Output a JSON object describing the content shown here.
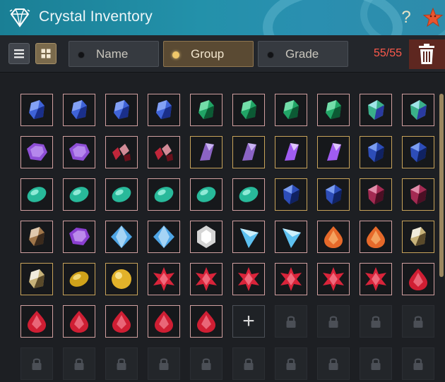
{
  "window": {
    "title": "Crystal Inventory",
    "help_label": "?"
  },
  "toolbar": {
    "sort_options": [
      {
        "label": "Name",
        "active": false
      },
      {
        "label": "Group",
        "active": true
      },
      {
        "label": "Grade",
        "active": false
      }
    ],
    "capacity": "55/55"
  },
  "colors": {
    "title_bar": "#1f8aa2",
    "count_text": "#ff5a4c",
    "active_tab": "#5a4a33",
    "trash_bg": "#5e2720"
  },
  "slot_rows": [
    [
      "sapphire-dark",
      "sapphire-dark",
      "sapphire-dark",
      "sapphire-dark",
      "emerald",
      "emerald",
      "emerald",
      "emerald",
      "aquamarine-blue",
      "aquamarine-blue"
    ],
    [
      "amethyst-hex",
      "amethyst-hex",
      "ruby-shards",
      "ruby-shards",
      "amethyst-shard",
      "amethyst-shard",
      "amethyst-glow",
      "amethyst-glow",
      "sapphire-rough",
      "sapphire-rough"
    ],
    [
      "jade-oval",
      "jade-oval",
      "jade-oval",
      "jade-oval",
      "jade-oval",
      "jade-oval",
      "sapphire-rough",
      "sapphire-rough",
      "garnet",
      "garnet"
    ],
    [
      "smoky-quartz",
      "amethyst-cluster",
      "diamond-blue",
      "diamond-blue",
      "diamond-white",
      "crystal-prism",
      "crystal-prism",
      "fire-opal",
      "fire-opal",
      "mixed-crystal"
    ],
    [
      "mixed-crystal",
      "topaz-egg",
      "topaz-round",
      "ruby-star",
      "ruby-star",
      "ruby-star",
      "ruby-star",
      "ruby-star",
      "ruby-star",
      "ruby-drop"
    ],
    [
      "ruby-drop",
      "ruby-drop",
      "ruby-drop",
      "ruby-drop",
      "ruby-drop",
      "add",
      "locked",
      "locked",
      "locked",
      "locked"
    ],
    [
      "locked",
      "locked",
      "locked",
      "locked",
      "locked",
      "locked",
      "locked",
      "locked",
      "locked",
      "locked"
    ]
  ]
}
